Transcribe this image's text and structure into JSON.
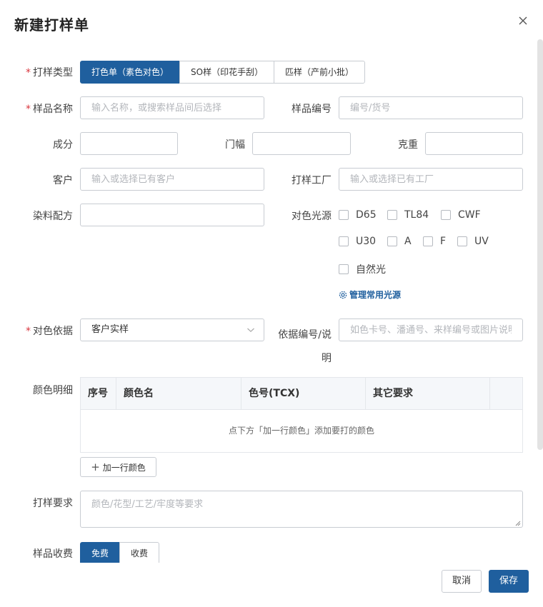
{
  "dialog": {
    "title": "新建打样单",
    "close_icon": "close-icon"
  },
  "sample_type": {
    "label": "打样类型",
    "required": "*",
    "options": [
      "打色单（素色对色）",
      "SO样（印花手刮）",
      "匹样（产前小批）"
    ],
    "selected": "打色单（素色对色）"
  },
  "sample_name": {
    "label": "样品名称",
    "required": "*",
    "placeholder": "输入名称，或搜索样品间后选择"
  },
  "sample_no": {
    "label": "样品编号",
    "placeholder": "编号/货号"
  },
  "composition": {
    "label": "成分",
    "value": ""
  },
  "width": {
    "label": "门幅",
    "value": ""
  },
  "weight": {
    "label": "克重",
    "value": ""
  },
  "customer": {
    "label": "客户",
    "placeholder": "输入或选择已有客户"
  },
  "factory": {
    "label": "打样工厂",
    "placeholder": "输入或选择已有工厂"
  },
  "dye_recipe": {
    "label": "染料配方",
    "value": ""
  },
  "light_source": {
    "label": "对色光源",
    "options": [
      "D65",
      "TL84",
      "CWF",
      "U30",
      "A",
      "F",
      "UV",
      "自然光"
    ],
    "manage_label": "管理常用光源",
    "manage_icon": "gear-icon"
  },
  "match_basis": {
    "label": "对色依据",
    "required": "*",
    "selected": "客户实样",
    "chevron_icon": "chevron-down-icon"
  },
  "basis_ref": {
    "label_line1": "依据编号/说",
    "label_line2": "明",
    "placeholder": "如色卡号、潘通号、来样编号或图片说明"
  },
  "color_detail": {
    "label": "颜色明细",
    "columns": [
      "序号",
      "颜色名",
      "色号(TCX)",
      "其它要求"
    ],
    "empty_text": "点下方「加一行颜色」添加要打的颜色",
    "add_button": "加一行颜色"
  },
  "requirements": {
    "label": "打样要求",
    "placeholder": "颜色/花型/工艺/牢度等要求"
  },
  "sample_fee": {
    "label": "样品收费",
    "options": [
      "免费",
      "收费"
    ],
    "selected": "免费"
  },
  "footer": {
    "cancel_label": "取消",
    "save_label": "保存"
  },
  "colors": {
    "primary": "#1f5f9e",
    "required": "#d9363e",
    "border": "#c8ccd2"
  }
}
